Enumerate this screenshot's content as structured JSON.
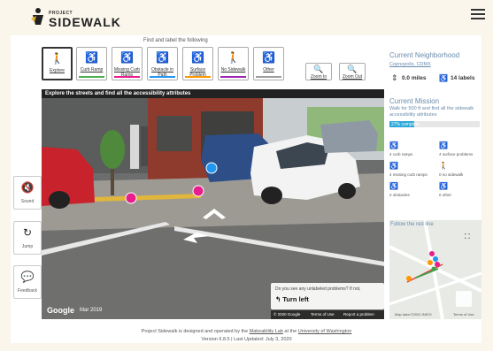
{
  "header": {
    "logo_small": "PROJECT",
    "logo_big": "SIDEWALK"
  },
  "toolbar": {
    "find_label": "Find and label the following",
    "tools": [
      {
        "label": "Explore",
        "icon": "walking-person-icon",
        "color": "#333333"
      },
      {
        "label": "Curb Ramp",
        "icon": "curb-ramp-icon",
        "color": "#4caf50"
      },
      {
        "label": "Missing Curb Ramp",
        "icon": "missing-curb-ramp-icon",
        "color": "#e91e8c"
      },
      {
        "label": "Obstacle in Path",
        "icon": "obstacle-icon",
        "color": "#2196f3"
      },
      {
        "label": "Surface Problem",
        "icon": "surface-problem-icon",
        "color": "#ff9800"
      },
      {
        "label": "No Sidewalk",
        "icon": "no-sidewalk-icon",
        "color": "#9c27b0"
      },
      {
        "label": "Other",
        "icon": "other-icon",
        "color": "#9e9e9e"
      }
    ],
    "zoom_in": "Zoom In",
    "zoom_out": "Zoom Out"
  },
  "streetview": {
    "header": "Explore the streets and find all the accessibility attributes",
    "google": "Google",
    "date": "Mar 2019",
    "problem_question": "Do you see any unlabeled problems? If not,",
    "turn_left": "Turn left",
    "footer_copyright": "© 2020 Google",
    "footer_terms": "Terms of Use",
    "footer_report": "Report a problem"
  },
  "side_buttons": [
    {
      "label": "Sound",
      "icon": "sound-muted-icon"
    },
    {
      "label": "Jump",
      "icon": "jump-icon"
    },
    {
      "label": "Feedback",
      "icon": "feedback-icon"
    }
  ],
  "neighborhood": {
    "title": "Current Neighborhood",
    "name": "Copnopolis, CDMX",
    "miles": "0.0 miles",
    "labels": "14 labels"
  },
  "mission": {
    "title": "Current Mission",
    "description": "Walk for 500 ft and find all the sidewalk accessibility attributes",
    "progress_text": "27% complete",
    "progress": 0.27
  },
  "stats": [
    {
      "label": "4 curb ramps",
      "icon": "curb-ramp-icon",
      "color": "#4caf50"
    },
    {
      "label": "4 surface problems",
      "icon": "surface-problem-icon",
      "color": "#ff9800"
    },
    {
      "label": "4 missing curb ramps",
      "icon": "missing-curb-ramp-icon",
      "color": "#e91e8c"
    },
    {
      "label": "0 no sidewalk",
      "icon": "no-sidewalk-icon",
      "color": "#9c27b0"
    },
    {
      "label": "2 obstacles",
      "icon": "obstacle-icon",
      "color": "#2196f3"
    },
    {
      "label": "0 other",
      "icon": "other-icon",
      "color": "#9e9e9e"
    }
  ],
  "minimap": {
    "follow_text": "Follow the red line",
    "map_data": "Map data ©2020 INEGI",
    "terms": "Terms of Use"
  },
  "footer": {
    "line1_pre": "Project Sidewalk is designed and operated by the",
    "lab": "Makeability Lab",
    "line1_mid": "at the",
    "university": "University of Washington",
    "version": "Version 6.8.5 | Last Updated: July 3, 2020"
  }
}
